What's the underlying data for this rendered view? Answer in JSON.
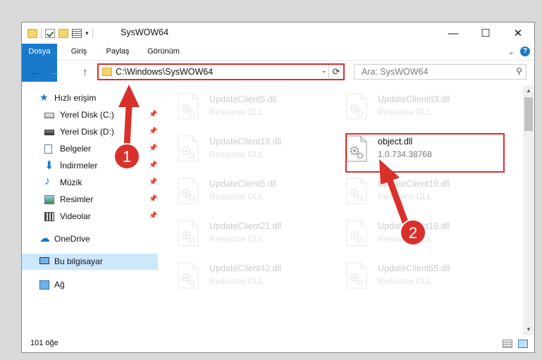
{
  "window": {
    "title": "SysWOW64",
    "controls": {
      "minimize": "—",
      "maximize": "☐",
      "close": "✕"
    }
  },
  "ribbon": {
    "tabs": [
      "Dosya",
      "Giriş",
      "Paylaş",
      "Görünüm"
    ],
    "collapse_glyph": "⌄",
    "help_glyph": "?"
  },
  "navigation": {
    "back": "←",
    "forward": "→",
    "up": "↑",
    "address": "C:\\Windows\\SysWOW64",
    "dropdown_glyph": "⌄",
    "refresh_glyph": "⟳",
    "search_placeholder": "Ara: SysWOW64",
    "search_glyph": "⚲"
  },
  "sidebar": {
    "quick_access": "Hızlı erişim",
    "items": [
      {
        "label": "Yerel Disk (C:)",
        "icon": "drive-icon",
        "pinned": true
      },
      {
        "label": "Yerel Disk (D:)",
        "icon": "drive-icon",
        "pinned": true
      },
      {
        "label": "Belgeler",
        "icon": "documents-icon",
        "pinned": true
      },
      {
        "label": "İndirmeler",
        "icon": "downloads-icon",
        "pinned": true
      },
      {
        "label": "Müzik",
        "icon": "music-icon",
        "pinned": true
      },
      {
        "label": "Resimler",
        "icon": "pictures-icon",
        "pinned": true
      },
      {
        "label": "Videolar",
        "icon": "videos-icon",
        "pinned": true
      }
    ],
    "onedrive": "OneDrive",
    "this_pc": "Bu bilgisayar",
    "network": "Ağ",
    "pin_glyph": "📌"
  },
  "files": [
    {
      "name": "UpdateClient5.dll",
      "desc": "Resource DLL",
      "faded": true
    },
    {
      "name": "UpdateClient63.dll",
      "desc": "Resource DLL",
      "faded": true
    },
    {
      "name": "UpdateClient19.dll",
      "desc": "Resource DLL",
      "faded": true
    },
    {
      "name": "object.dll",
      "desc": "1.0.734.38768",
      "faded": false
    },
    {
      "name": "UpdateClient5.dll",
      "desc": "Resource DLL",
      "faded": true
    },
    {
      "name": "UpdateClient19.dll",
      "desc": "Resource DLL",
      "faded": true
    },
    {
      "name": "UpdateClient21.dll",
      "desc": "Resource DLL",
      "faded": true
    },
    {
      "name": "UpdateClient19.dll",
      "desc": "Resource DLL",
      "faded": true
    },
    {
      "name": "UpdateClient42.dll",
      "desc": "Resource DLL",
      "faded": true
    },
    {
      "name": "UpdateClient65.dll",
      "desc": "Resource DLL",
      "faded": true
    }
  ],
  "status": {
    "count": "101 öğe"
  },
  "annotations": {
    "step1": "1",
    "step2": "2",
    "color": "#d9302c"
  }
}
